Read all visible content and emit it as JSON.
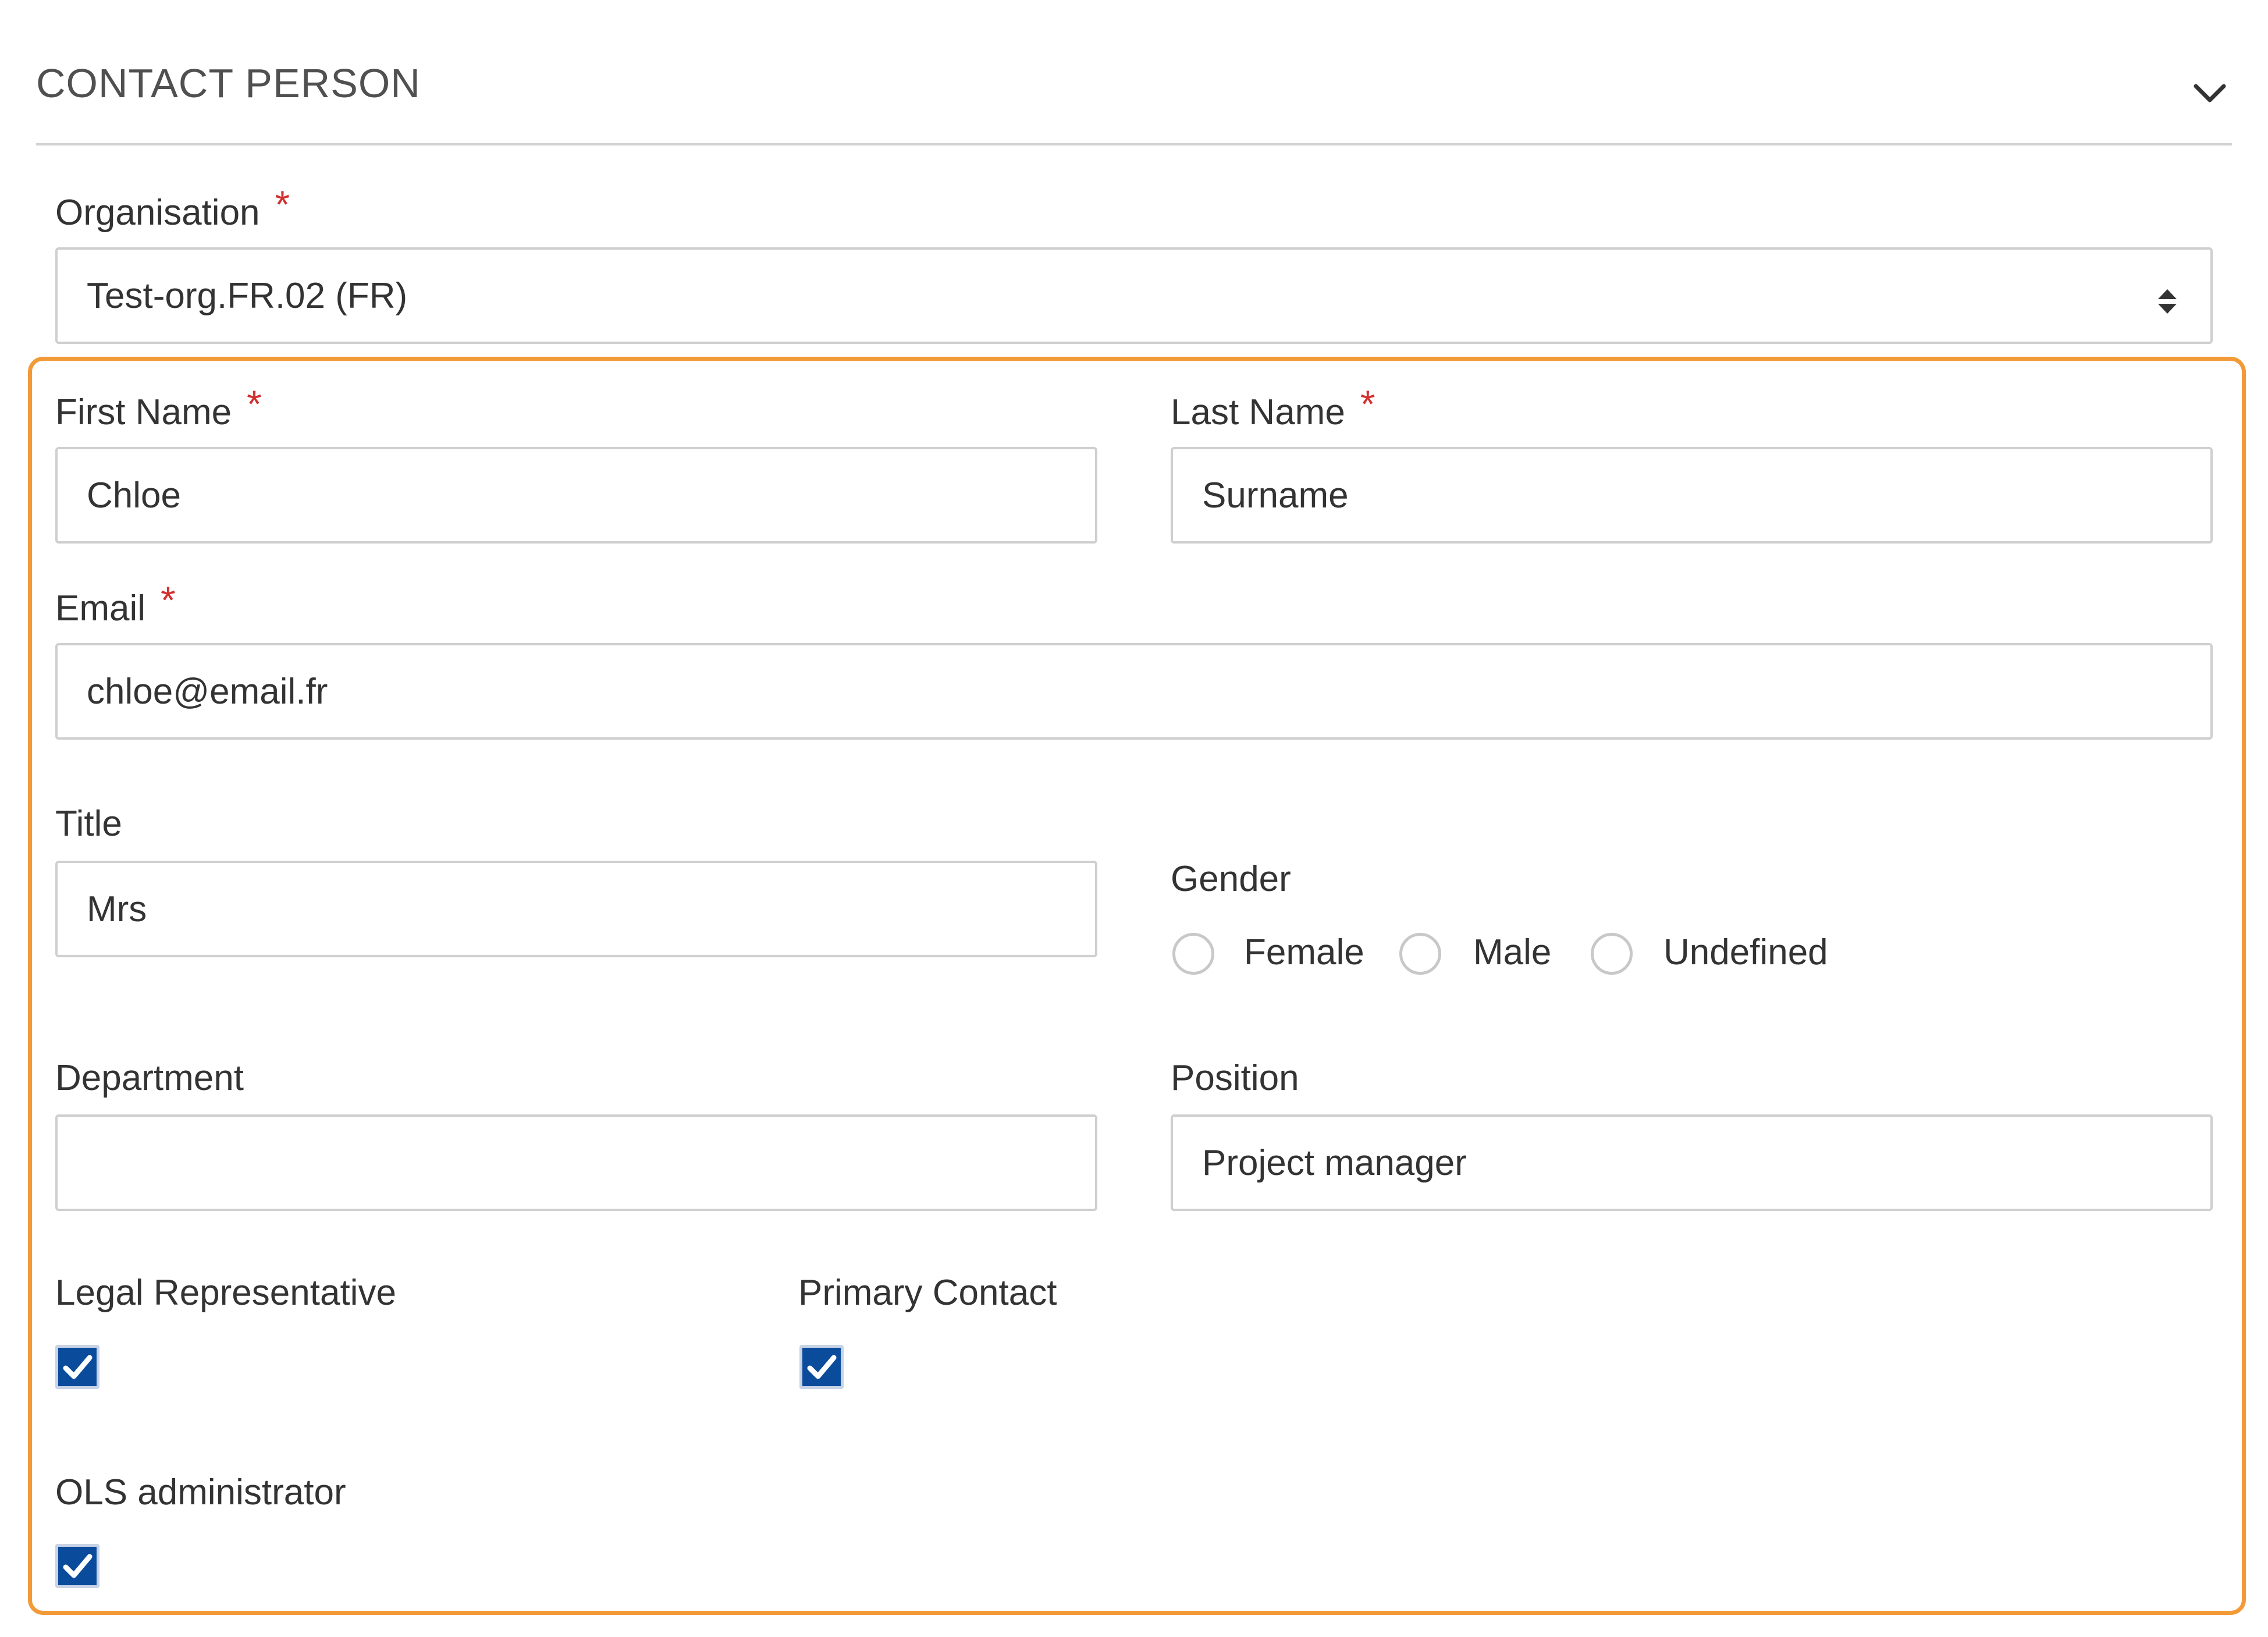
{
  "section": {
    "title": "CONTACT PERSON"
  },
  "organisation": {
    "label": "Organisation",
    "required_mark": "*",
    "value": "Test-org.FR.02 (FR)"
  },
  "first_name": {
    "label": "First Name",
    "required_mark": "*",
    "value": "Chloe"
  },
  "last_name": {
    "label": "Last Name",
    "required_mark": "*",
    "value": "Surname"
  },
  "email": {
    "label": "Email",
    "required_mark": "*",
    "value": "chloe@email.fr"
  },
  "title_field": {
    "label": "Title",
    "value": "Mrs"
  },
  "gender": {
    "label": "Gender",
    "options": [
      "Female",
      "Male",
      "Undefined"
    ],
    "selected": null
  },
  "department": {
    "label": "Department",
    "value": ""
  },
  "position": {
    "label": "Position",
    "value": "Project manager"
  },
  "legal_representative": {
    "label": "Legal Representative",
    "checked": true
  },
  "primary_contact": {
    "label": "Primary Contact",
    "checked": true
  },
  "ols_administrator": {
    "label": "OLS administrator",
    "checked": true
  },
  "colors": {
    "highlight_border": "#f29a38",
    "required_asterisk": "#d32f2f",
    "checkbox_fill": "#0a4b9c",
    "input_border": "#cfcfcf"
  },
  "icons": {
    "section_toggle": "chevron-down-icon",
    "select": "sort-arrows-icon"
  }
}
